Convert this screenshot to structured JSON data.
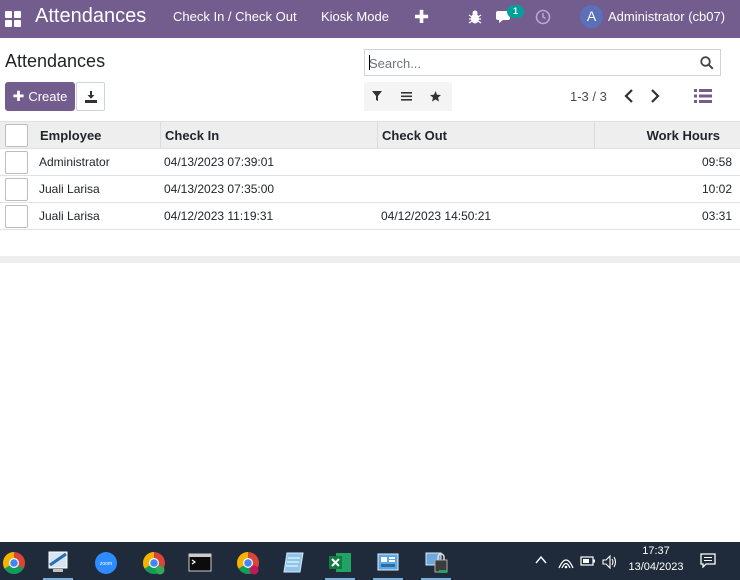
{
  "navbar": {
    "app_title": "Attendances",
    "menu": [
      "Check In / Check Out",
      "Kiosk Mode"
    ],
    "chat_badge": "1",
    "avatar_letter": "A",
    "user": "Administrator (cb07)"
  },
  "control_panel": {
    "title": "Attendances",
    "search_placeholder": "Search...",
    "create_label": "Create",
    "pager_value": "1-3 / 3"
  },
  "table": {
    "columns": [
      "Employee",
      "Check In",
      "Check Out",
      "Work Hours"
    ],
    "rows": [
      {
        "employee": "Administrator",
        "check_in": "04/13/2023 07:39:01",
        "check_out": "",
        "work_hours": "09:58"
      },
      {
        "employee": "Juali Larisa",
        "check_in": "04/13/2023 07:35:00",
        "check_out": "",
        "work_hours": "10:02"
      },
      {
        "employee": "Juali Larisa",
        "check_in": "04/12/2023 11:19:31",
        "check_out": "04/12/2023 14:50:21",
        "work_hours": "03:31"
      }
    ]
  },
  "taskbar": {
    "time": "17:37",
    "date": "13/04/2023",
    "apps": [
      "chrome-icon",
      "remote-desktop-icon",
      "zoom-icon",
      "chrome-icon",
      "terminal-icon",
      "chrome-icon",
      "notes-icon",
      "excel-icon",
      "control-panel-icon",
      "vpn-icon"
    ]
  },
  "colors": {
    "brand": "#735d8f",
    "badge": "#00a09d",
    "taskbar": "#1f2b3a"
  }
}
